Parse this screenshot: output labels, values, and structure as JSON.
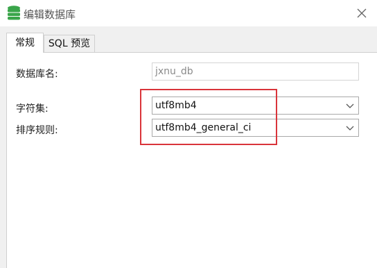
{
  "window": {
    "title": "编辑数据库",
    "app_icon": "database-icon",
    "close_icon": "close-icon"
  },
  "tabs": [
    {
      "label": "常规",
      "active": true
    },
    {
      "label": "SQL 预览",
      "active": false
    }
  ],
  "form": {
    "db_name_label": "数据库名:",
    "db_name_value": "jxnu_db",
    "charset_label": "字符集:",
    "charset_value": "utf8mb4",
    "collation_label": "排序规则:",
    "collation_value": "utf8mb4_general_ci"
  },
  "colors": {
    "highlight": "#d9343a",
    "icon_green": "#3aa54a"
  }
}
